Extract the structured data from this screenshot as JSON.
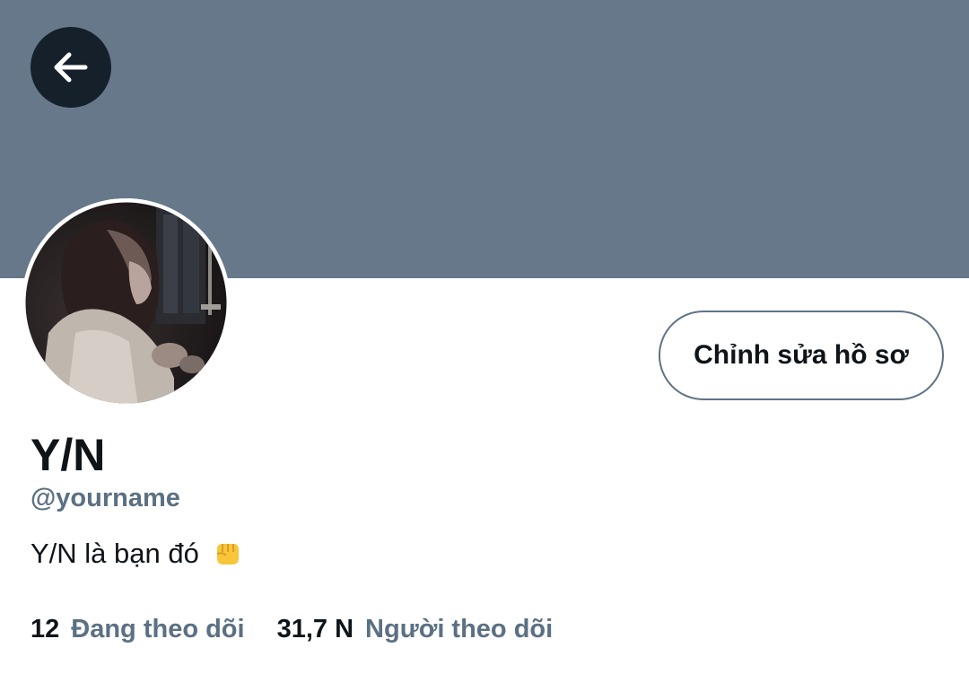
{
  "profile": {
    "banner_color": "#66788a",
    "display_name": "Y/N",
    "handle": "@yourname",
    "bio": "Y/N là bạn đó",
    "bio_emoji": "oncoming-fist-emoji",
    "edit_button_label": "Chỉnh sửa hồ sơ"
  },
  "stats": {
    "following_count": "12",
    "following_label": "Đang theo dõi",
    "followers_count": "31,7 N",
    "followers_label": "Người theo dõi"
  },
  "icons": {
    "back": "arrow-left-icon"
  },
  "colors": {
    "text_primary": "#0f1419",
    "text_secondary": "#5b7083",
    "back_button_bg": "#15202b"
  }
}
